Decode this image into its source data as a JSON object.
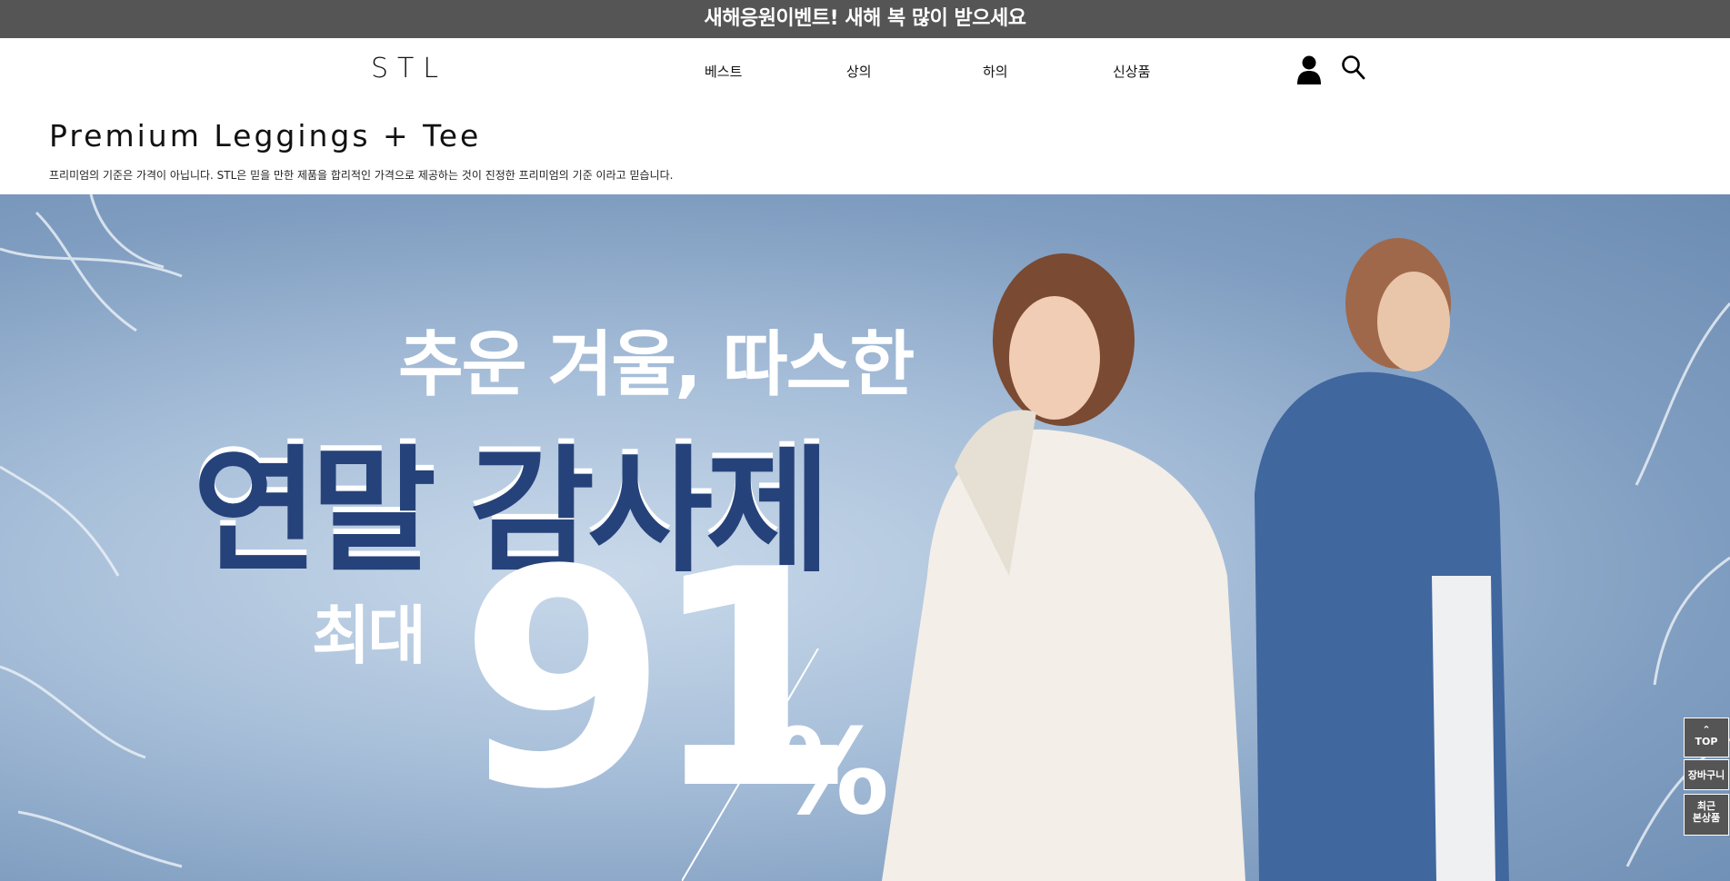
{
  "topbar": {
    "text": "새해응원이벤트! 새해 복 많이 받으세요"
  },
  "header": {
    "logo": "STL",
    "nav": [
      "베스트",
      "상의",
      "하의",
      "신상품"
    ]
  },
  "page": {
    "title": "Premium Leggings + Tee",
    "subtitle": "프리미엄의 기준은 가격이 아닙니다. STL은 믿을 만한 제품을 합리적인 가격으로 제공하는 것이 진정한 프리미엄의 기준 이라고 믿습니다."
  },
  "banner": {
    "line1": "추운 겨울, 따스한",
    "line2": "연말 감사제",
    "max_label": "최대",
    "number": "91",
    "percent": "%"
  },
  "side": {
    "top_arrow": "⌃",
    "top": "TOP",
    "cart": "장바구니",
    "recent_line1": "최근",
    "recent_line2": "본상품"
  },
  "colors": {
    "topbar": "#555555",
    "banner_blue": "#26427a"
  }
}
